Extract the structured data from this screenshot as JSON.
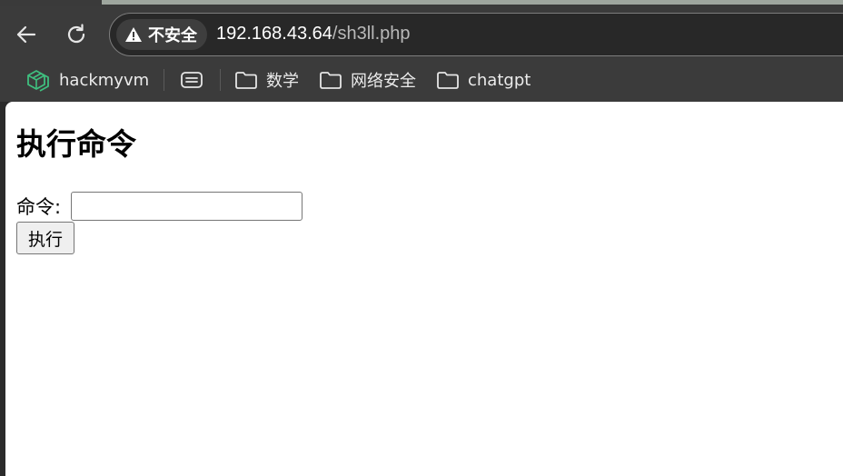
{
  "browser": {
    "security_label": "不安全",
    "url_host": "192.168.43.64",
    "url_path": "/sh3ll.php",
    "icons": {
      "back": "arrow-left-icon",
      "refresh": "refresh-icon",
      "security": "warning-triangle-icon"
    }
  },
  "bookmarks": {
    "items": [
      {
        "label": "hackmyvm",
        "icon": "hackmyvm-logo-icon"
      },
      {
        "label": "",
        "icon": "reading-list-icon"
      },
      {
        "label": "数学",
        "icon": "folder-icon"
      },
      {
        "label": "网络安全",
        "icon": "folder-icon"
      },
      {
        "label": "chatgpt",
        "icon": "folder-icon"
      }
    ]
  },
  "page": {
    "title": "执行命令",
    "command_label": "命令:",
    "command_value": "",
    "submit_label": "执行"
  },
  "colors": {
    "toolbar_bg": "#3b3b3b",
    "address_bg": "#282828",
    "page_bg": "#ffffff",
    "hackmyvm_accent": "#3fbf7f"
  }
}
